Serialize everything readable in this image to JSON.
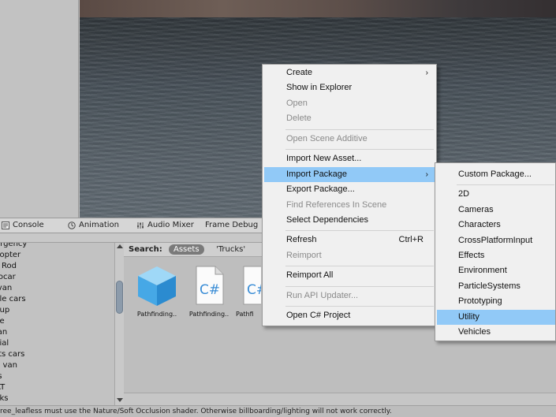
{
  "tabs": [
    {
      "label": "Console",
      "icon": "console-icon"
    },
    {
      "label": "Animation",
      "icon": "animation-clock-icon"
    },
    {
      "label": "Audio Mixer",
      "icon": "audio-mixer-icon"
    },
    {
      "label": "Frame Debug",
      "icon": ""
    }
  ],
  "hierarchy": {
    "items": [
      "ergency",
      "copter",
      "Rod",
      "rocar",
      "ivan",
      "cle cars",
      "cup",
      "ce",
      "lan",
      "cial",
      "rts cars",
      "p van",
      "/s",
      "AT",
      "cks"
    ]
  },
  "search": {
    "label": "Search:",
    "scope": "Assets",
    "query": "'Trucks'"
  },
  "assets": [
    {
      "label": "Pathfinding..",
      "icon": "prefab-cube-icon"
    },
    {
      "label": "Pathfinding..",
      "icon": "csharp-script-icon"
    },
    {
      "label": "Pathfi",
      "icon": "csharp-script-icon"
    }
  ],
  "status_message": "ree_leafless must use the Nature/Soft Occlusion shader. Otherwise billboarding/lighting will not work correctly.",
  "context_menu": {
    "items": [
      {
        "label": "Create",
        "submenu": true
      },
      {
        "label": "Show in Explorer"
      },
      {
        "label": "Open",
        "disabled": true
      },
      {
        "label": "Delete",
        "disabled": true
      },
      {
        "label": "Open Scene Additive",
        "disabled": true
      },
      {
        "label": "Import New Asset..."
      },
      {
        "label": "Import Package",
        "submenu": true,
        "highlighted": true
      },
      {
        "label": "Export Package..."
      },
      {
        "label": "Find References In Scene",
        "disabled": true
      },
      {
        "label": "Select Dependencies"
      },
      {
        "label": "Refresh",
        "shortcut": "Ctrl+R"
      },
      {
        "label": "Reimport",
        "disabled": true
      },
      {
        "label": "Reimport All"
      },
      {
        "label": "Run API Updater...",
        "disabled": true
      },
      {
        "label": "Open C# Project"
      }
    ]
  },
  "import_package_submenu": {
    "items": [
      "Custom Package...",
      "2D",
      "Cameras",
      "Characters",
      "CrossPlatformInput",
      "Effects",
      "Environment",
      "ParticleSystems",
      "Prototyping",
      "Utility",
      "Vehicles"
    ],
    "highlighted": "Utility"
  },
  "colors": {
    "menu_highlight": "#91c9f7",
    "search_pill": "#7a7a7a"
  }
}
